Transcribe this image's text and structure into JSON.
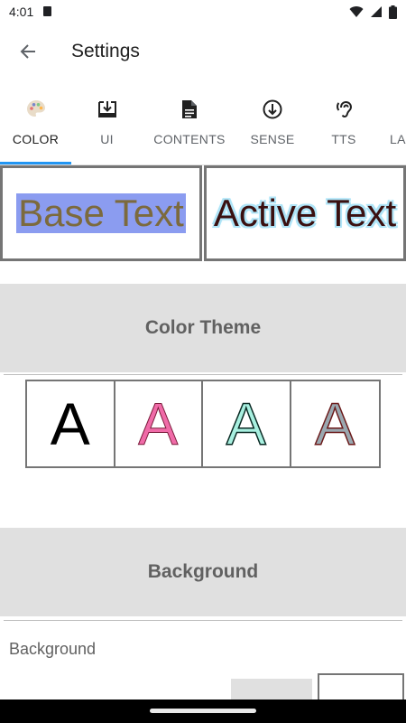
{
  "status_bar": {
    "time": "4:01"
  },
  "app_bar": {
    "title": "Settings"
  },
  "tabs": [
    {
      "label": "COLOR",
      "icon": "palette-icon",
      "active": true
    },
    {
      "label": "UI",
      "icon": "download-box-icon",
      "active": false
    },
    {
      "label": "CONTENTS",
      "icon": "document-icon",
      "active": false
    },
    {
      "label": "SENSE",
      "icon": "arrow-circle-down-icon",
      "active": false
    },
    {
      "label": "TTS",
      "icon": "hearing-icon",
      "active": false
    },
    {
      "label": "LA",
      "icon": "",
      "active": false
    }
  ],
  "preview": {
    "base_text": "Base Text",
    "active_text": "Active Text"
  },
  "color_theme": {
    "title": "Color Theme",
    "swatches": [
      {
        "letter": "A",
        "fill": "#000000",
        "stroke": "none"
      },
      {
        "letter": "A",
        "fill": "#f06ba8",
        "stroke": "#7a1a3a"
      },
      {
        "letter": "A",
        "fill": "#a8f0e0",
        "stroke": "#0a2a24"
      },
      {
        "letter": "A",
        "fill": "#9aa8b0",
        "stroke": "#6b1a1a"
      }
    ]
  },
  "background": {
    "title": "Background",
    "label": "Background",
    "swatches": [
      "#e0e0e0",
      "#ffffff"
    ]
  },
  "colors": {
    "accent": "#2196f3",
    "section_bg": "#e0e0e0",
    "base_highlight": "#8b9cf0",
    "active_glow": "#aee4f7"
  }
}
